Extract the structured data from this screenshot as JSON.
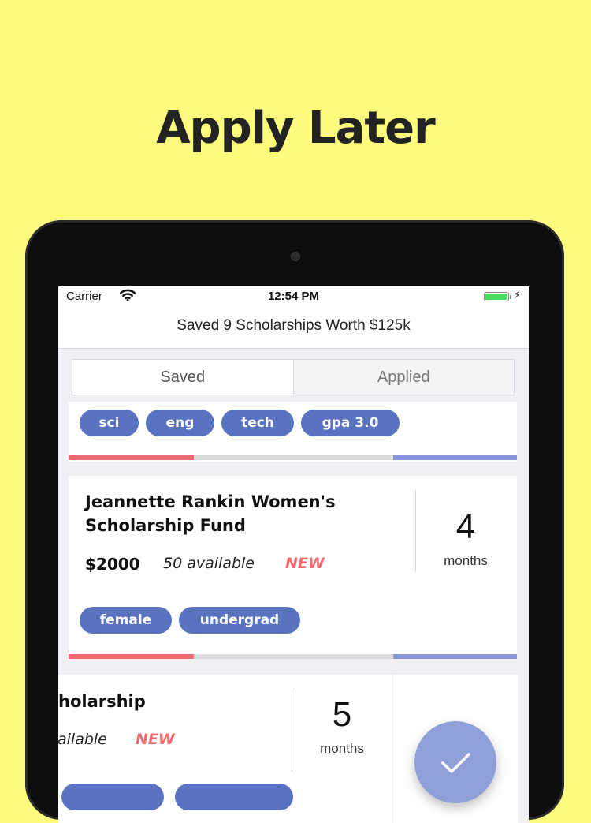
{
  "headline": "Apply Later",
  "status_bar": {
    "carrier": "Carrier",
    "time": "12:54 PM"
  },
  "nav": {
    "title": "Saved 9 Scholarships Worth $125k"
  },
  "segments": {
    "saved": "Saved",
    "applied": "Applied",
    "selected": "Saved"
  },
  "card_top": {
    "tags": [
      "sci",
      "eng",
      "tech",
      "gpa 3.0"
    ]
  },
  "card_main": {
    "title_line1": "Jeannette Rankin Women's",
    "title_line2": "Scholarship Fund",
    "amount": "$2000",
    "available": "50 available",
    "new_badge": "NEW",
    "deadline_value": "4",
    "deadline_unit": "months",
    "tags": [
      "female",
      "undergrad"
    ]
  },
  "card_bottom": {
    "title_fragment": "holarship",
    "available_fragment": "ailable",
    "new_badge": "NEW",
    "deadline_value": "5",
    "deadline_unit": "months"
  },
  "colors": {
    "background": "#fdfb7d",
    "tag": "#5a73c0",
    "new_badge": "#ee6a6f",
    "progress_red": "#ee6a6f",
    "progress_blue": "#8597d6",
    "fab": "#8f9fd8",
    "battery": "#4cd964"
  },
  "icons": {
    "wifi": "wifi-icon",
    "battery": "battery-icon",
    "charging": "bolt-icon",
    "action_button": "checkmark-icon"
  }
}
